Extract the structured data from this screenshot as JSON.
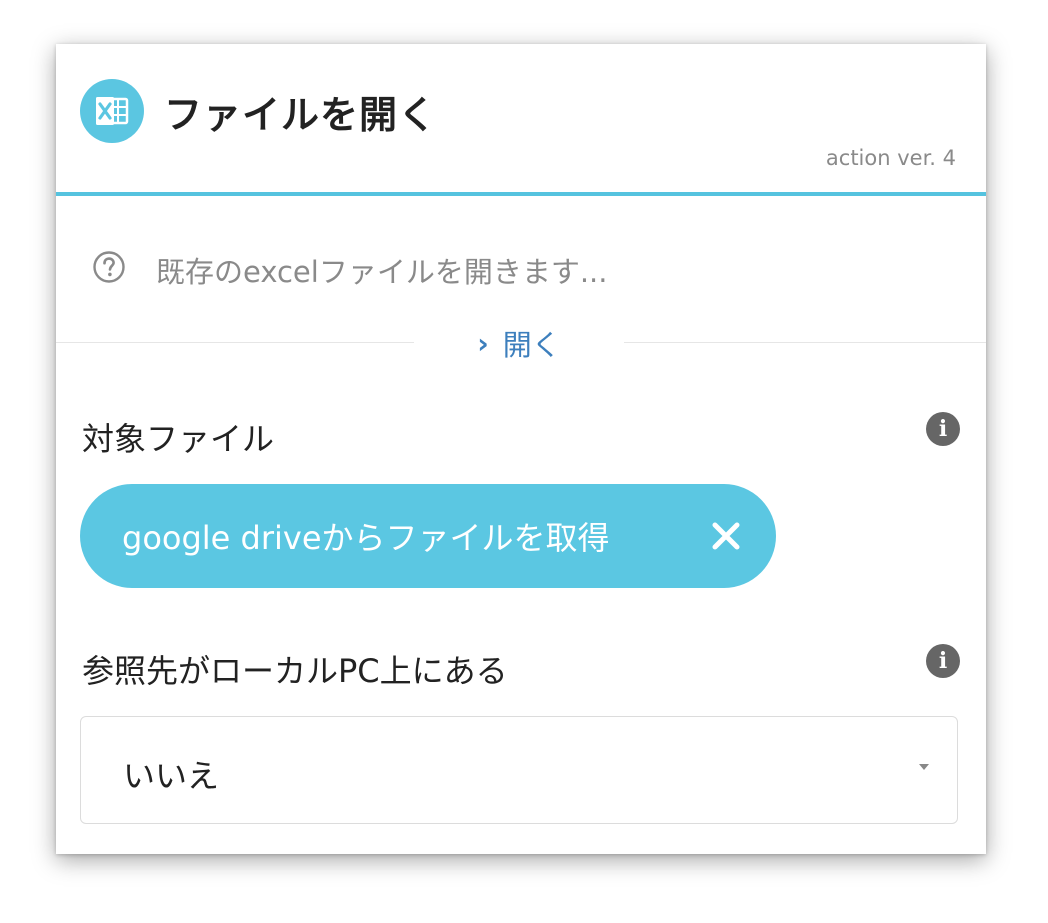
{
  "header": {
    "icon": "excel-icon",
    "title": "ファイルを開く",
    "version": "action ver. 4"
  },
  "description": {
    "icon": "help-circle-icon",
    "text": "既存のexcelファイルを開きます..."
  },
  "toggle": {
    "icon": "chevron-right-icon",
    "label": "開く"
  },
  "fields": [
    {
      "label": "対象ファイル",
      "info_icon": "info-icon",
      "chip": {
        "label": "google driveからファイルを取得",
        "close_icon": "close-icon"
      }
    },
    {
      "label": "参照先がローカルPC上にある",
      "info_icon": "info-icon",
      "select": {
        "value": "いいえ",
        "caret_icon": "caret-down-icon"
      }
    }
  ],
  "colors": {
    "accent": "#5bc7e2",
    "link": "#3d7fbd",
    "muted_text": "#8a8a8a"
  }
}
